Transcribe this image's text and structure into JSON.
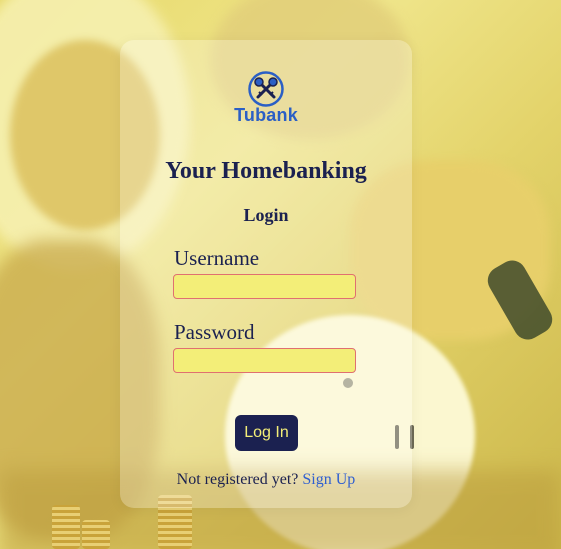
{
  "brand": {
    "name": "Tubank",
    "icon": "crossed-keys-icon",
    "color": "#2b5fc5"
  },
  "page": {
    "title": "Your Homebanking",
    "subtitle": "Login"
  },
  "form": {
    "username_label": "Username",
    "username_value": "",
    "password_label": "Password",
    "password_value": "",
    "submit_label": "Log In"
  },
  "footer": {
    "prompt": "Not registered yet?",
    "signup_link": "Sign Up"
  },
  "colors": {
    "primary": "#1b2150",
    "accent": "#f3ee78",
    "link": "#2f5fd0",
    "input_border": "#e07070"
  }
}
